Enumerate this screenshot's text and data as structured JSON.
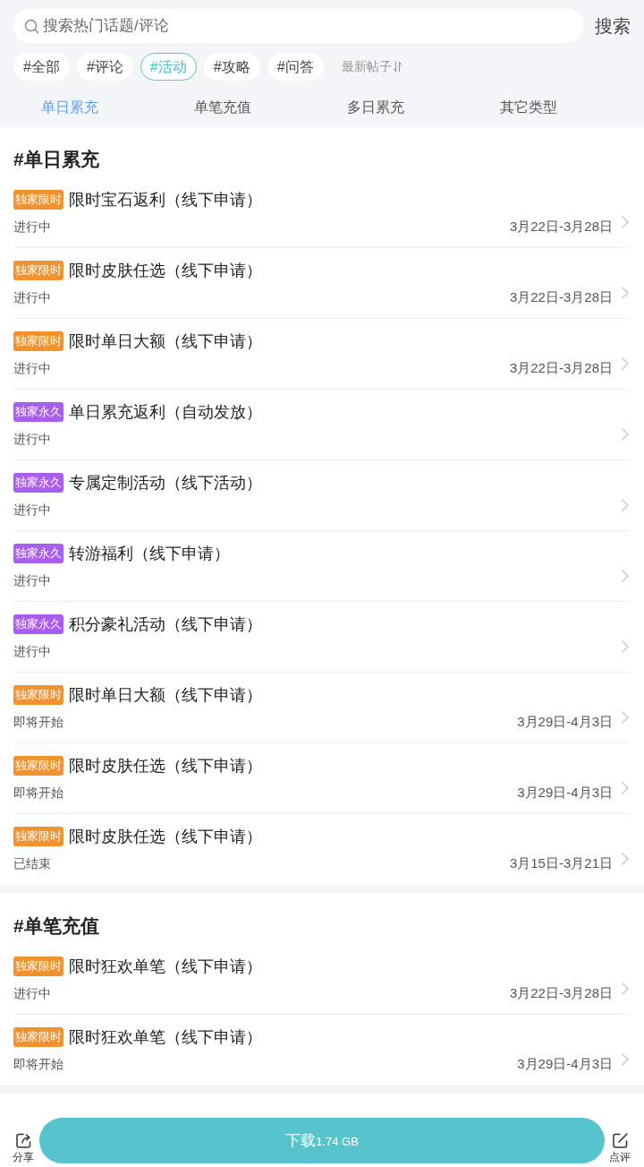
{
  "search": {
    "placeholder": "搜索热门话题/评论",
    "button": "搜索"
  },
  "filters": [
    {
      "label": "#全部",
      "selected": false
    },
    {
      "label": "#评论",
      "selected": false
    },
    {
      "label": "#活动",
      "selected": true
    },
    {
      "label": "#攻略",
      "selected": false
    },
    {
      "label": "#问答",
      "selected": false
    }
  ],
  "sort": {
    "label": "最新帖子"
  },
  "tabs": [
    {
      "label": "单日累充",
      "selected": true
    },
    {
      "label": "单笔充值",
      "selected": false
    },
    {
      "label": "多日累充",
      "selected": false
    },
    {
      "label": "其它类型",
      "selected": false
    }
  ],
  "sections": [
    {
      "title": "#单日累充",
      "items": [
        {
          "badge": {
            "label": "独家限时",
            "color": "#f0922e"
          },
          "title": "限时宝石返利（线下申请）",
          "status": "进行中",
          "dates": "3月22日-3月28日"
        },
        {
          "badge": {
            "label": "独家限时",
            "color": "#f0922e"
          },
          "title": "限时皮肤任选（线下申请）",
          "status": "进行中",
          "dates": "3月22日-3月28日"
        },
        {
          "badge": {
            "label": "独家限时",
            "color": "#f0922e"
          },
          "title": "限时单日大额（线下申请）",
          "status": "进行中",
          "dates": "3月22日-3月28日"
        },
        {
          "badge": {
            "label": "独家永久",
            "color": "#a95ef0"
          },
          "title": "单日累充返利（自动发放）",
          "status": "进行中"
        },
        {
          "badge": {
            "label": "独家永久",
            "color": "#a95ef0"
          },
          "title": "专属定制活动（线下活动）",
          "status": "进行中"
        },
        {
          "badge": {
            "label": "独家永久",
            "color": "#a95ef0"
          },
          "title": "转游福利（线下申请）",
          "status": "进行中"
        },
        {
          "badge": {
            "label": "独家永久",
            "color": "#a95ef0"
          },
          "title": "积分豪礼活动（线下申请）",
          "status": "进行中"
        },
        {
          "badge": {
            "label": "独家限时",
            "color": "#f0922e"
          },
          "title": "限时单日大额（线下申请）",
          "status": "即将开始",
          "dates": "3月29日-4月3日"
        },
        {
          "badge": {
            "label": "独家限时",
            "color": "#f0922e"
          },
          "title": "限时皮肤任选（线下申请）",
          "status": "即将开始",
          "dates": "3月29日-4月3日"
        },
        {
          "badge": {
            "label": "独家限时",
            "color": "#f0922e"
          },
          "title": "限时皮肤任选（线下申请）",
          "status": "已结束",
          "dates": "3月15日-3月21日"
        }
      ]
    },
    {
      "title": "#单笔充值",
      "items": [
        {
          "badge": {
            "label": "独家限时",
            "color": "#f0922e"
          },
          "title": "限时狂欢单笔（线下申请）",
          "status": "进行中",
          "dates": "3月22日-3月28日"
        },
        {
          "badge": {
            "label": "独家限时",
            "color": "#f0922e"
          },
          "title": "限时狂欢单笔（线下申请）",
          "status": "即将开始",
          "dates": "3月29日-4月3日"
        }
      ]
    }
  ],
  "bottom_bar": {
    "share": "分享",
    "download": {
      "label": "下载",
      "size": "1.74 GB"
    },
    "review": "点评"
  }
}
